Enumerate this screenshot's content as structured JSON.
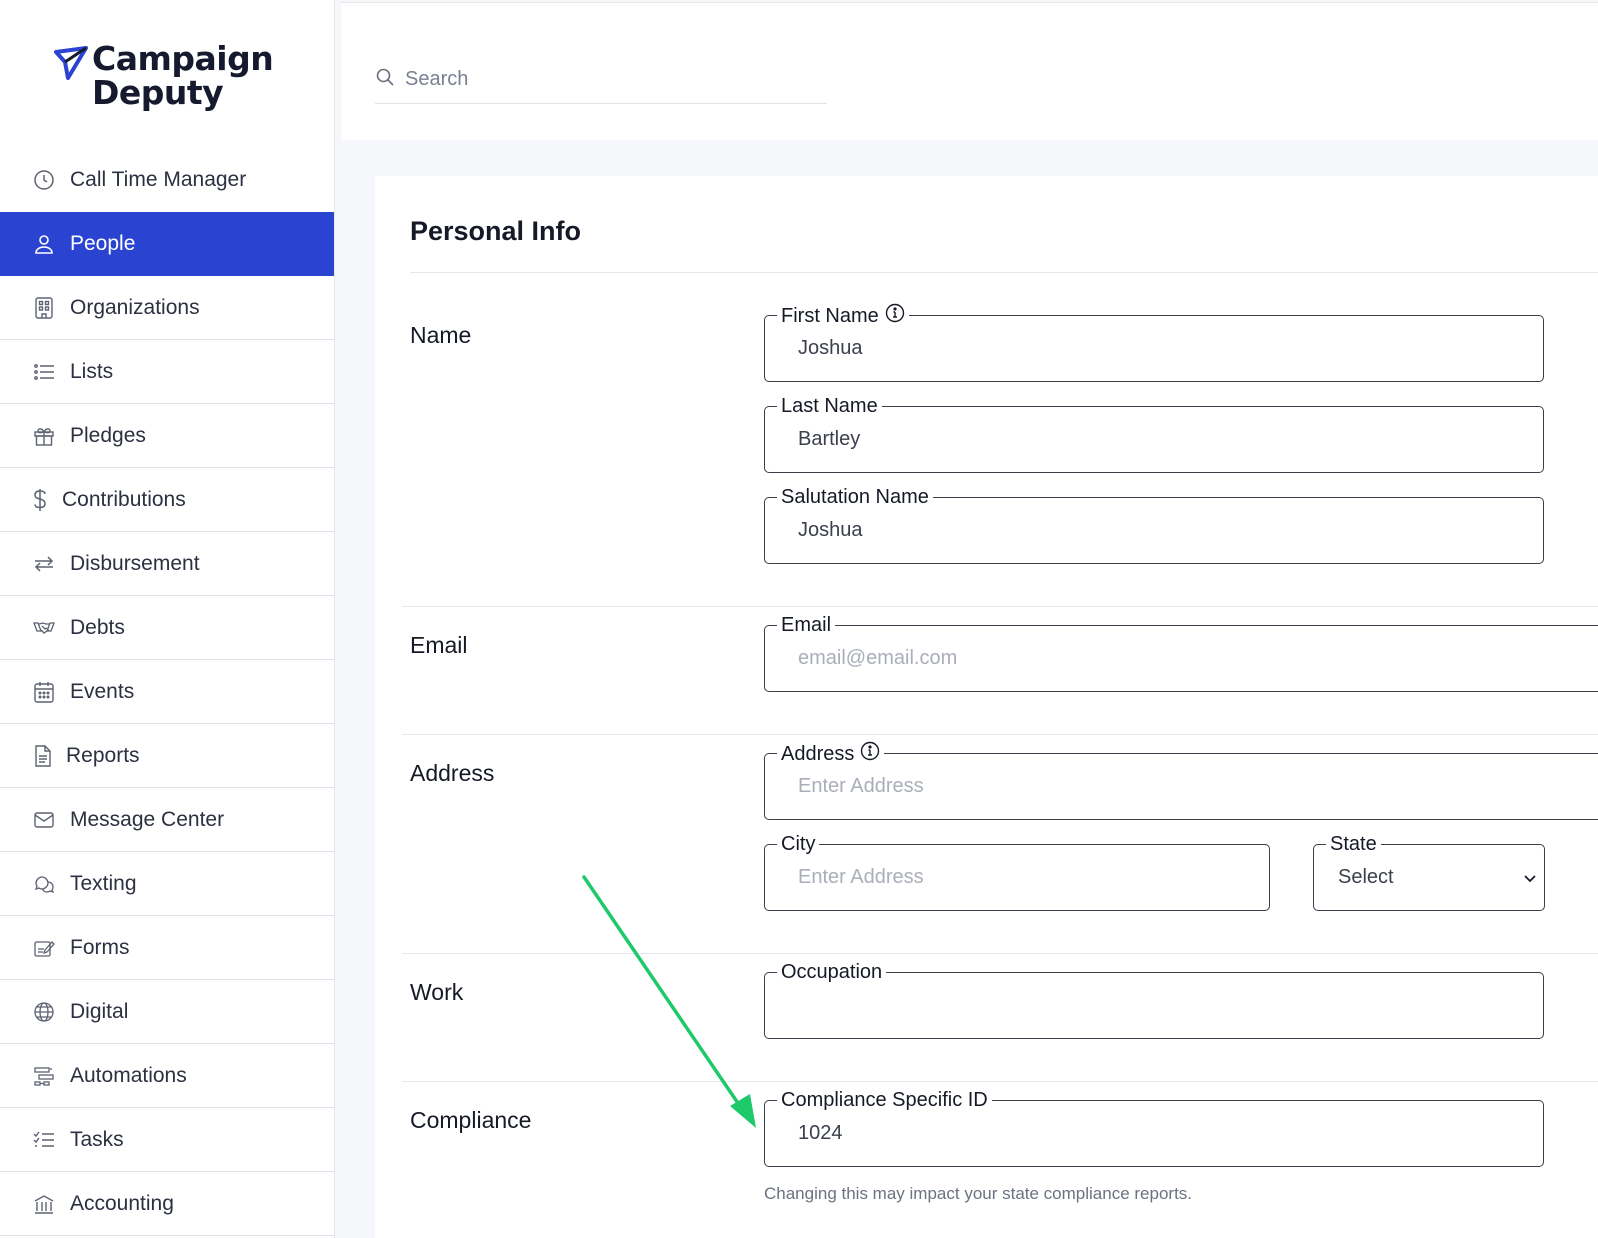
{
  "brand": {
    "line1": "Campaign",
    "line2": "Deputy",
    "accent": "#2a44d1"
  },
  "sidebar": {
    "items": [
      {
        "label": "Call Time Manager",
        "icon": "clock-icon"
      },
      {
        "label": "People",
        "icon": "person-icon",
        "active": true
      },
      {
        "label": "Organizations",
        "icon": "building-icon"
      },
      {
        "label": "Lists",
        "icon": "list-icon"
      },
      {
        "label": "Pledges",
        "icon": "gift-icon"
      },
      {
        "label": "Contributions",
        "icon": "dollar-icon"
      },
      {
        "label": "Disbursement",
        "icon": "transfer-arrows-icon"
      },
      {
        "label": "Debts",
        "icon": "handshake-icon"
      },
      {
        "label": "Events",
        "icon": "calendar-icon"
      },
      {
        "label": "Reports",
        "icon": "document-icon"
      },
      {
        "label": "Message Center",
        "icon": "envelope-icon"
      },
      {
        "label": "Texting",
        "icon": "chat-icon"
      },
      {
        "label": "Forms",
        "icon": "form-edit-icon"
      },
      {
        "label": "Digital",
        "icon": "globe-icon"
      },
      {
        "label": "Automations",
        "icon": "automation-icon"
      },
      {
        "label": "Tasks",
        "icon": "checklist-icon"
      },
      {
        "label": "Accounting",
        "icon": "accounting-icon"
      }
    ]
  },
  "search": {
    "placeholder": "Search"
  },
  "card": {
    "title": "Personal Info",
    "sections": {
      "name": "Name",
      "email": "Email",
      "address": "Address",
      "work": "Work",
      "compliance": "Compliance"
    },
    "fields": {
      "first_name": {
        "label": "First Name",
        "value": "Joshua"
      },
      "last_name": {
        "label": "Last Name",
        "value": "Bartley"
      },
      "salutation": {
        "label": "Salutation Name",
        "value": "Joshua"
      },
      "email": {
        "label": "Email",
        "placeholder": "email@email.com"
      },
      "address": {
        "label": "Address",
        "placeholder": "Enter Address"
      },
      "city": {
        "label": "City",
        "placeholder": "Enter Address"
      },
      "state": {
        "label": "State",
        "value": "Select"
      },
      "occupation": {
        "label": "Occupation",
        "value": ""
      },
      "compliance_id": {
        "label": "Compliance Specific ID",
        "value": "1024"
      }
    },
    "compliance_note": "Changing this may impact your state compliance reports."
  },
  "annotation_arrow_color": "#1ec96a"
}
